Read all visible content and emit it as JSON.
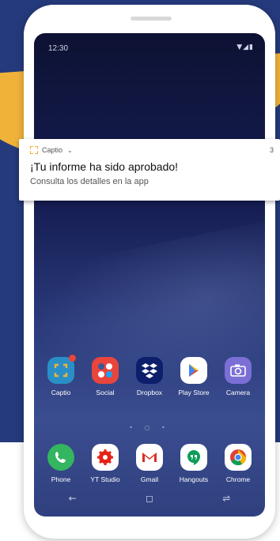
{
  "status_bar": {
    "time": "12:30",
    "icons": "▼◢▮"
  },
  "notification": {
    "app_name": "Captio",
    "chevron": "⌄",
    "count": "3",
    "title": "¡Tu informe ha sido aprobado!",
    "body": "Consulta los detalles en la app"
  },
  "apps_row1": [
    {
      "label": "Captio",
      "icon": "captio-icon",
      "bg": "#2a8fc7"
    },
    {
      "label": "Social",
      "icon": "social-folder-icon",
      "bg": "#e8453c"
    },
    {
      "label": "Dropbox",
      "icon": "dropbox-icon",
      "bg": "#0d1f6b"
    },
    {
      "label": "Play Store",
      "icon": "play-store-icon",
      "bg": "#ffffff"
    },
    {
      "label": "Camera",
      "icon": "camera-icon",
      "bg": "#7b6fd6"
    }
  ],
  "apps_row2": [
    {
      "label": "Phone",
      "icon": "phone-icon",
      "bg": "#34b55f"
    },
    {
      "label": "YT Studio",
      "icon": "yt-studio-icon",
      "bg": "#ffffff"
    },
    {
      "label": "Gmail",
      "icon": "gmail-icon",
      "bg": "#ffffff"
    },
    {
      "label": "Hangouts",
      "icon": "hangouts-icon",
      "bg": "#ffffff"
    },
    {
      "label": "Chrome",
      "icon": "chrome-icon",
      "bg": "#ffffff"
    }
  ],
  "page_dots": "• ○ •",
  "nav": {
    "back": "←",
    "home": "◻",
    "recents": "⇌"
  },
  "colors": {
    "accent": "#f0b33a",
    "background": "#253a7c"
  }
}
